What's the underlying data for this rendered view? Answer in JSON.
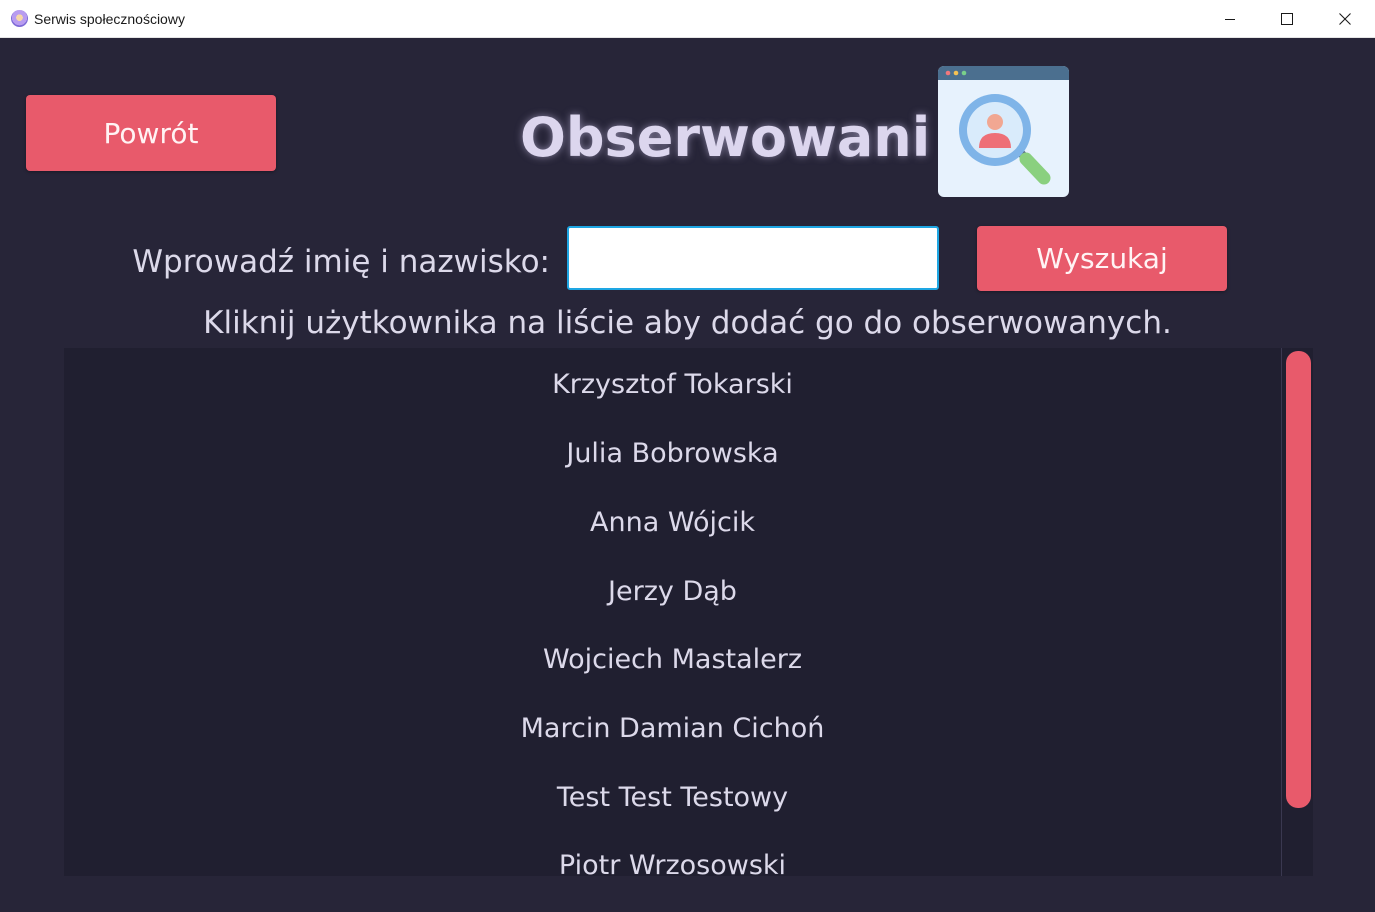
{
  "window": {
    "title": "Serwis społecznościowy"
  },
  "header": {
    "back_label": "Powrót",
    "page_title": "Obserwowani",
    "logo_icon": "user-search-icon"
  },
  "search": {
    "label": "Wprowadź imię i nazwisko:",
    "value": "",
    "placeholder": "",
    "button_label": "Wyszukaj"
  },
  "hint": "Kliknij użytkownika na liście aby dodać go do obserwowanych.",
  "users": [
    "Krzysztof Tokarski",
    "Julia Bobrowska",
    "Anna Wójcik",
    "Jerzy Dąb",
    "Wojciech Mastalerz",
    "Marcin Damian Cichoń",
    "Test Test Testowy",
    "Piotr Wrzosowski"
  ],
  "colors": {
    "background": "#272538",
    "list_background": "#201f30",
    "accent": "#e85a6b",
    "text": "#dcd9ea",
    "input_focus": "#1ea6e3"
  }
}
